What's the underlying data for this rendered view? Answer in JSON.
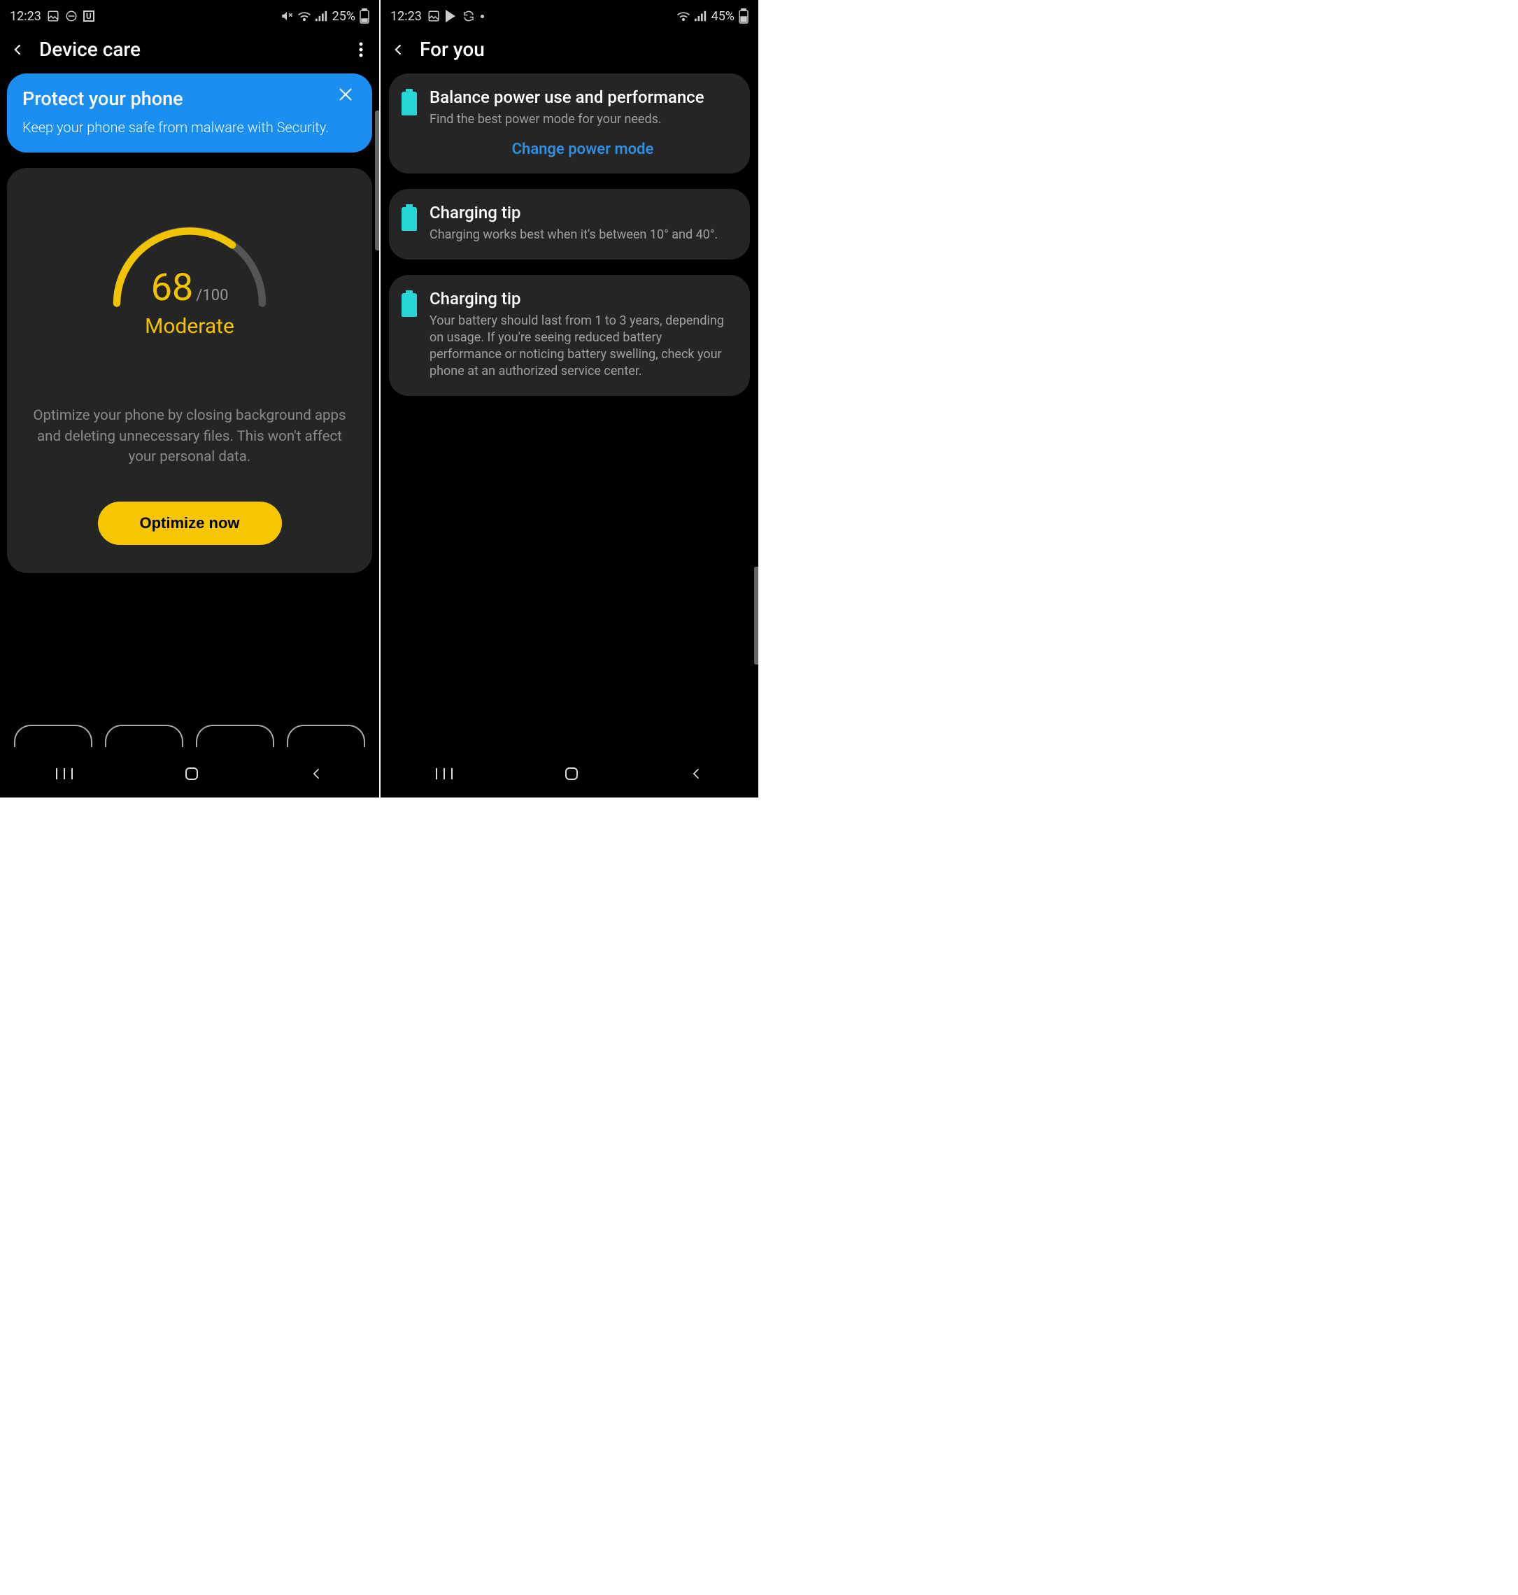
{
  "left": {
    "status": {
      "time": "12:23",
      "battery": "25%"
    },
    "header": {
      "title": "Device care"
    },
    "protect": {
      "title": "Protect your phone",
      "body": "Keep your phone safe from malware with Security."
    },
    "score": {
      "value": "68",
      "max": "/100",
      "label": "Moderate",
      "desc": "Optimize your phone by closing background apps and deleting unnecessary files. This won't affect your personal data.",
      "button": "Optimize now"
    }
  },
  "right": {
    "status": {
      "time": "12:23",
      "battery": "45%"
    },
    "header": {
      "title": "For you"
    },
    "tips": [
      {
        "title": "Balance power use and performance",
        "desc": "Find the best power mode for your needs.",
        "action": "Change power mode"
      },
      {
        "title": "Charging tip",
        "desc": "Charging works best when it's between 10° and 40°."
      },
      {
        "title": "Charging tip",
        "desc": "Your battery should last from 1 to 3 years, depending on usage. If you're seeing reduced battery performance or noticing battery swelling, check your phone at an authorized service center."
      }
    ]
  }
}
